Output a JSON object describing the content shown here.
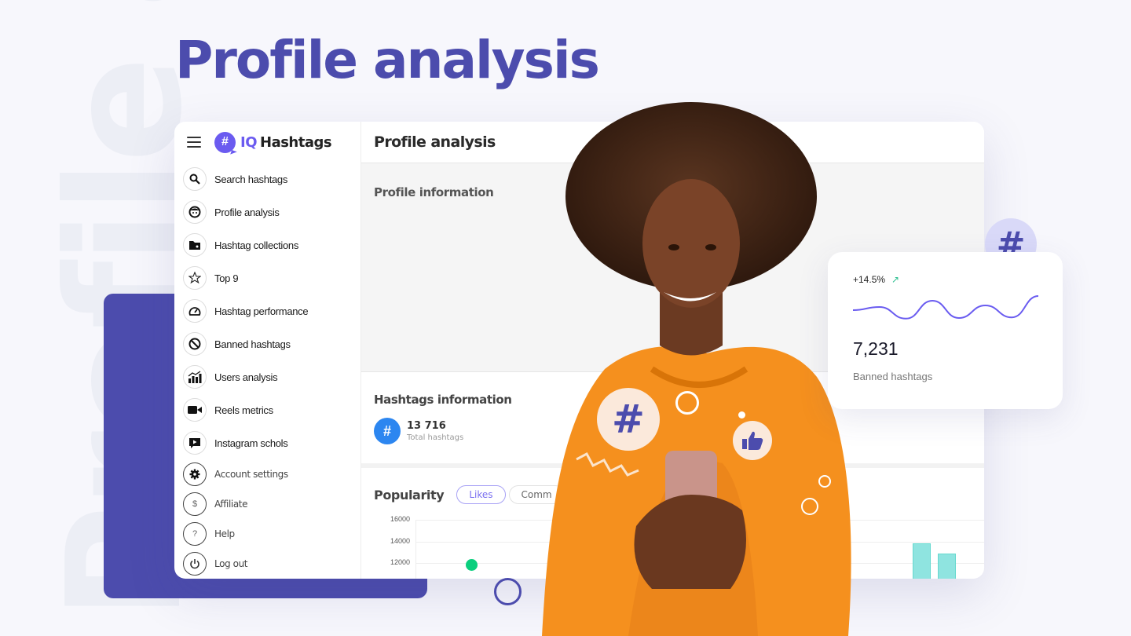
{
  "hero": {
    "title": "Profile analysis",
    "background_text": "Profile analysis"
  },
  "app": {
    "brand": {
      "prefix": "IQ",
      "name": "Hashtags",
      "logo_glyph": "#"
    },
    "menu_icon": "hamburger-icon",
    "sidebar": {
      "items": [
        {
          "label": "Search hashtags",
          "icon": "search-icon"
        },
        {
          "label": "Profile analysis",
          "icon": "face-icon"
        },
        {
          "label": "Hashtag collections",
          "icon": "folder-star-icon"
        },
        {
          "label": "Top 9",
          "icon": "star-icon"
        },
        {
          "label": "Hashtag performance",
          "icon": "gauge-icon"
        },
        {
          "label": "Banned hashtags",
          "icon": "ban-icon"
        },
        {
          "label": "Users analysis",
          "icon": "bar-chart-icon"
        },
        {
          "label": "Reels metrics",
          "icon": "video-camera-icon"
        },
        {
          "label": "Instagram schols",
          "icon": "play-message-icon"
        }
      ],
      "footer_items": [
        {
          "label": "Account settings",
          "icon": "gear-icon"
        },
        {
          "label": "Affiliate",
          "icon": "dollar-icon"
        },
        {
          "label": "Help",
          "icon": "question-icon"
        },
        {
          "label": "Log out",
          "icon": "power-icon"
        }
      ]
    },
    "main": {
      "title": "Profile analysis",
      "profile_info_title": "Profile information",
      "hashtags_info": {
        "title": "Hashtags information",
        "total_value": "13 716",
        "total_label": "Total hashtags"
      },
      "popularity": {
        "title": "Popularity",
        "tabs": [
          {
            "label": "Likes",
            "active": true
          },
          {
            "label": "Comm",
            "active": false
          }
        ]
      }
    }
  },
  "chart_data": {
    "type": "scatter",
    "title": "Popularity",
    "metric": "Likes",
    "yticks": [
      "16000",
      "14000",
      "12000"
    ],
    "ylim": [
      12000,
      16000
    ],
    "points": [
      {
        "x": 1,
        "y": 11850,
        "color": "#0bcf7e"
      }
    ],
    "bars": [
      {
        "value": 13800,
        "color": "#8fe4e0"
      },
      {
        "value": 12900,
        "color": "#8fe4e0"
      }
    ]
  },
  "stat_card": {
    "change": "+14.5%",
    "trend_icon": "trending-up-icon",
    "value": "7,231",
    "label": "Banned hashtags",
    "sparkline": [
      0.45,
      0.35,
      0.72,
      0.15,
      0.7,
      0.3,
      0.68,
      0.0
    ]
  },
  "decor": {
    "hash_bubble_glyph": "#",
    "speech_hash_glyph": "#",
    "thumbs_glyph": "👍"
  }
}
